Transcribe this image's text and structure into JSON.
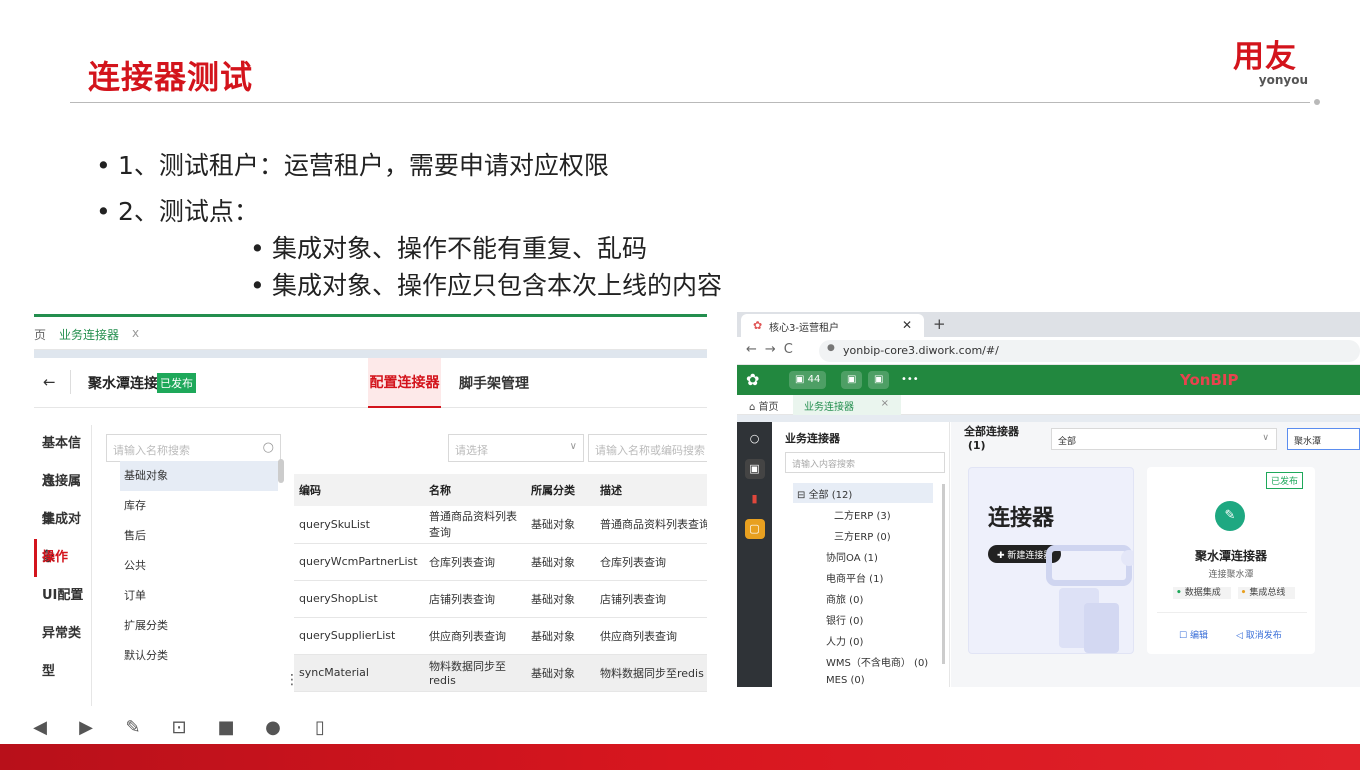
{
  "title": "连接器测试",
  "logo": {
    "cn": "用友",
    "en": "yonyou"
  },
  "bullets": [
    {
      "text": "1、测试租户：运营租户，需要申请对应权限"
    },
    {
      "text": "2、测试点："
    },
    {
      "text": "集成对象、操作不能有重复、乱码"
    },
    {
      "text": "集成对象、操作应只包含本次上线的内容"
    }
  ],
  "left_shot": {
    "tab_edge": "页",
    "tab_label": "业务连接器",
    "tab_close": "x",
    "back_icon": "←",
    "connector_name": "聚水潭连接器",
    "status_badge": "已发布",
    "tab_config": "配置连接器",
    "tab_scaffold": "脚手架管理",
    "side_items": [
      "基本信息",
      "连接属性",
      "集成对象",
      "操作",
      "UI配置",
      "异常类型"
    ],
    "active_side": "操作",
    "search_placeholder": "请输入名称搜索",
    "tree_items": [
      "基础对象",
      "库存",
      "售后",
      "公共",
      "订单",
      "扩展分类",
      "默认分类"
    ],
    "selected_tree": "基础对象",
    "select_placeholder": "请选择",
    "search2_placeholder": "请输入名称或编码搜索",
    "columns": [
      "编码",
      "名称",
      "所属分类",
      "描述"
    ],
    "rows": [
      [
        "querySkuList",
        "普通商品资料列表查询",
        "基础对象",
        "普通商品资料列表查询"
      ],
      [
        "queryWcmPartnerList",
        "仓库列表查询",
        "基础对象",
        "仓库列表查询"
      ],
      [
        "queryShopList",
        "店铺列表查询",
        "基础对象",
        "店铺列表查询"
      ],
      [
        "querySupplierList",
        "供应商列表查询",
        "基础对象",
        "供应商列表查询"
      ],
      [
        "syncMaterial",
        "物料数据同步至redis",
        "基础对象",
        "物料数据同步至redis"
      ]
    ]
  },
  "right_shot": {
    "browser_tab": "核心3-运营租户",
    "url": "yonbip-core3.diwork.com/#/",
    "badge_count": "44",
    "brand": "YonBIP",
    "home_tab": "首页",
    "page_tab": "业务连接器",
    "tree_title": "业务连接器",
    "tree_search_placeholder": "请输入内容搜索",
    "tree_root": "全部 (12)",
    "tree_items": [
      "二方ERP (3)",
      "三方ERP (0)",
      "协同OA (1)",
      "电商平台 (1)",
      "商旅 (0)",
      "银行 (0)",
      "人力 (0)",
      "WMS（不含电商） (0)",
      "MES (0)"
    ],
    "main_title": "全部连接器",
    "main_count": "(1)",
    "filter_value": "全部",
    "keyword_value": "聚水潭",
    "hero_title": "连接器",
    "new_button": "新建连接器",
    "card_status": "已发布",
    "card_name": "聚水潭连接器",
    "card_sub": "连接聚水潭",
    "card_tags": [
      "数据集成",
      "集成总线"
    ],
    "card_edit": "编辑",
    "card_unpublish": "取消发布"
  },
  "colors": {
    "accent_red": "#d3141c",
    "green": "#238e4e"
  },
  "toolbar_icons": [
    "prev-icon",
    "next-icon",
    "pen-icon",
    "screenshot-icon",
    "camera-icon",
    "more-icon",
    "device-icon"
  ]
}
